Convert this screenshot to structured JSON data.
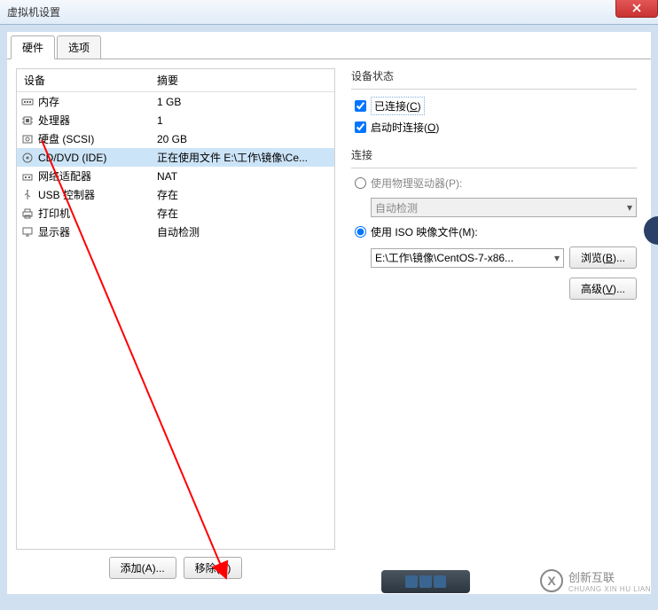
{
  "title": "虚拟机设置",
  "tabs": {
    "hardware": "硬件",
    "options": "选项"
  },
  "hw_table": {
    "header_device": "设备",
    "header_summary": "摘要",
    "rows": [
      {
        "icon": "memory",
        "label": "内存",
        "summary": "1 GB",
        "selected": false
      },
      {
        "icon": "cpu",
        "label": "处理器",
        "summary": "1",
        "selected": false
      },
      {
        "icon": "disk",
        "label": "硬盘 (SCSI)",
        "summary": "20 GB",
        "selected": false
      },
      {
        "icon": "cd",
        "label": "CD/DVD (IDE)",
        "summary": "正在使用文件 E:\\工作\\镜像\\Ce...",
        "selected": true
      },
      {
        "icon": "net",
        "label": "网络适配器",
        "summary": "NAT",
        "selected": false
      },
      {
        "icon": "usb",
        "label": "USB 控制器",
        "summary": "存在",
        "selected": false
      },
      {
        "icon": "printer",
        "label": "打印机",
        "summary": "存在",
        "selected": false
      },
      {
        "icon": "display",
        "label": "显示器",
        "summary": "自动检测",
        "selected": false
      }
    ]
  },
  "buttons": {
    "add": "添加(A)...",
    "remove": "移除(R)"
  },
  "right": {
    "device_status_title": "设备状态",
    "connected_label": "已连接(C)",
    "connect_on_power_label": "启动时连接(O)",
    "connection_title": "连接",
    "use_physical_label": "使用物理驱动器(P):",
    "physical_combo": "自动检测",
    "use_iso_label": "使用 ISO 映像文件(M):",
    "iso_path": "E:\\工作\\镜像\\CentOS-7-x86...",
    "browse": "浏览(B)...",
    "advanced": "高级(V)..."
  },
  "watermark": {
    "brand": "创新互联",
    "sub": "CHUANG XIN HU LIAN"
  }
}
